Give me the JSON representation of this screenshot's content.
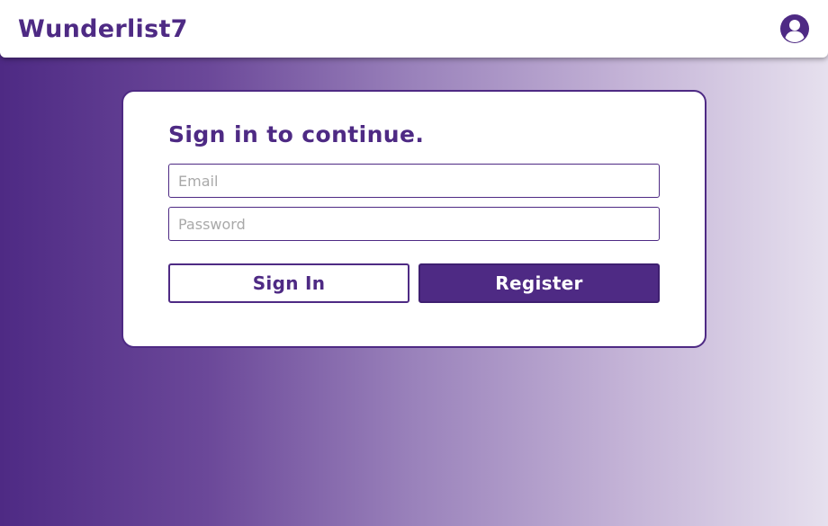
{
  "header": {
    "brand": "Wunderlist7",
    "account_icon": "user-circle-icon"
  },
  "login": {
    "title": "Sign in to continue.",
    "email": {
      "value": "",
      "placeholder": "Email"
    },
    "password": {
      "value": "",
      "placeholder": "Password"
    },
    "signin_label": "Sign In",
    "register_label": "Register"
  },
  "colors": {
    "accent": "#4e2a84",
    "background_gradient_start": "#4e2a84",
    "background_gradient_end": "#e6e0ee",
    "surface": "#ffffff"
  }
}
